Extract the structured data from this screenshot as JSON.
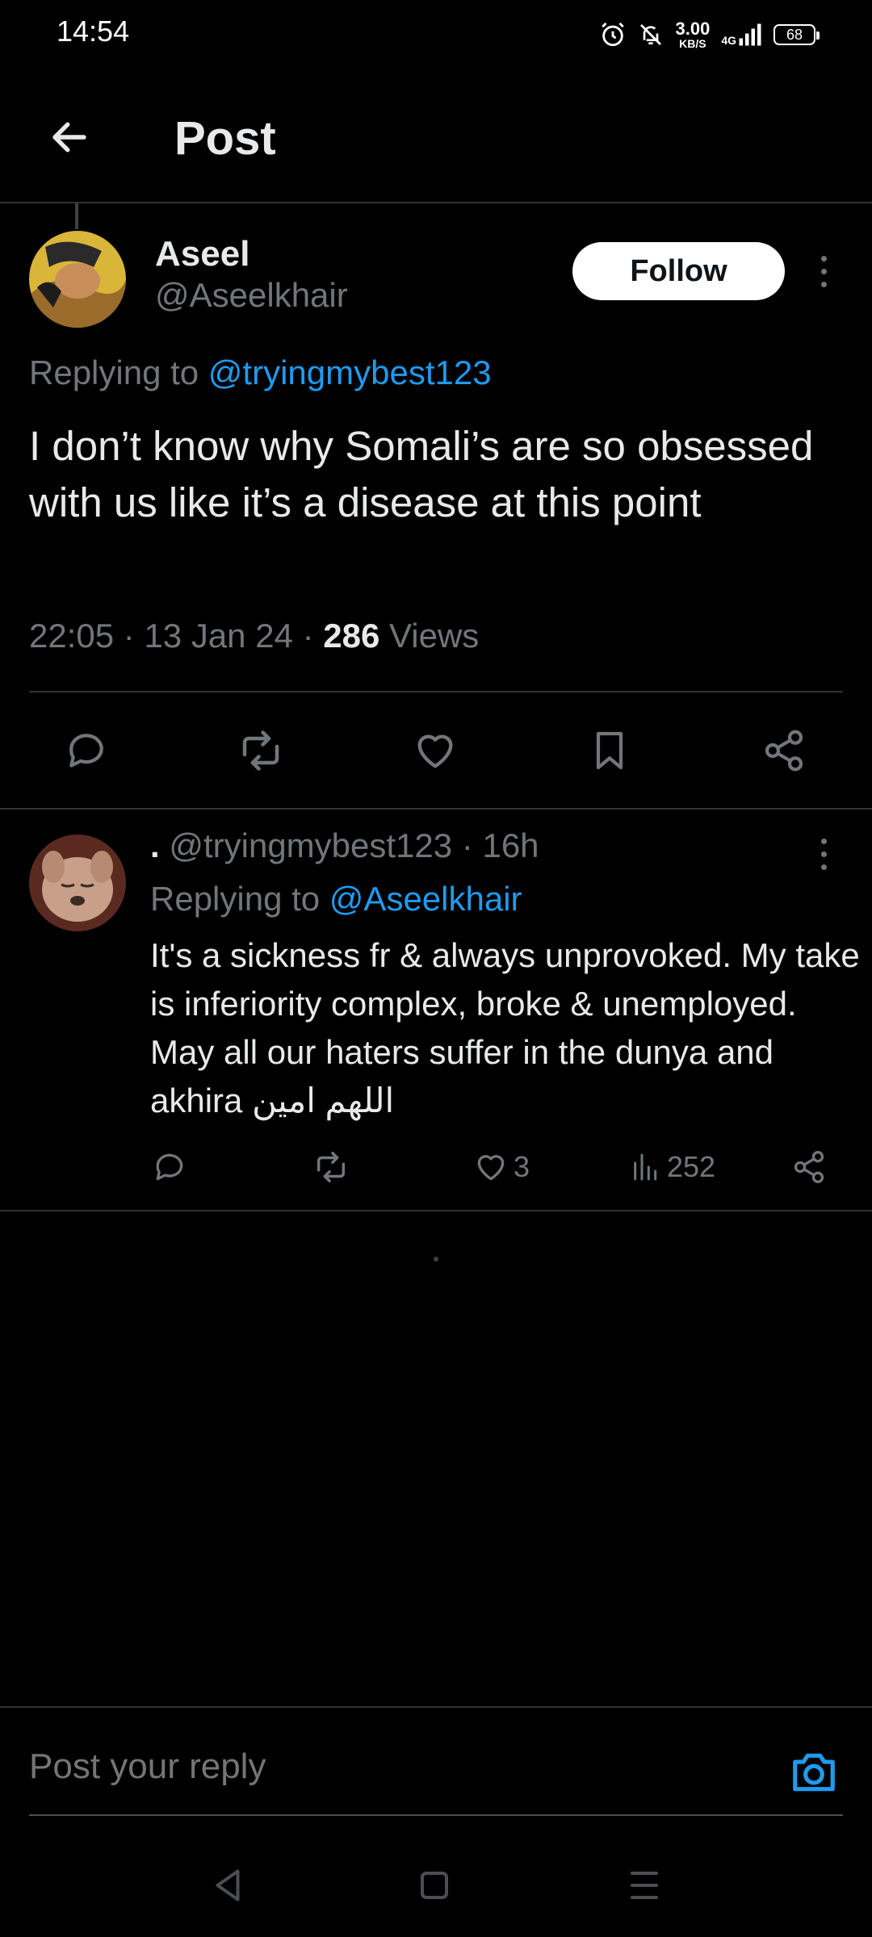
{
  "status_bar": {
    "time": "14:54",
    "net_speed": "3.00",
    "net_unit": "KB/S",
    "network": "4G",
    "battery": "68"
  },
  "header": {
    "title": "Post"
  },
  "post": {
    "author_name": "Aseel",
    "author_handle": "@Aseelkhair",
    "follow_label": "Follow",
    "replying_prefix": "Replying to",
    "replying_to": "@tryingmybest123",
    "text": "I don’t know why Somali’s are so obsessed with us like it’s a disease at this point",
    "time": "22:05",
    "date": "13 Jan 24",
    "views_count": "286",
    "views_label": "Views"
  },
  "reply": {
    "display_name": ".",
    "handle": "@tryingmybest123",
    "age": "16h",
    "replying_prefix": "Replying to",
    "replying_to": "@Aseelkhair",
    "text": "It's a sickness fr & always unprovoked. My take is inferiority complex, broke & unemployed. May all our haters suffer in the dunya and akhira اللهم امين",
    "likes": "3",
    "views": "252"
  },
  "composer": {
    "placeholder": "Post your reply"
  },
  "colors": {
    "accent": "#1d9bf0",
    "muted": "#71767b",
    "background": "#000000",
    "divider": "#2f3336"
  }
}
